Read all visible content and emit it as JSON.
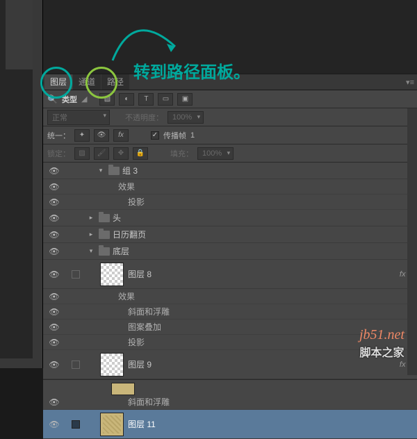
{
  "annotation": {
    "text": "转到路径面板。"
  },
  "tabs": {
    "layers": "图层",
    "channels": "通道",
    "paths": "路径"
  },
  "filter": {
    "label": "类型"
  },
  "blend": {
    "mode": "正常",
    "opacity_label": "不透明度：",
    "opacity_value": "100%"
  },
  "unify": {
    "label": "统一：",
    "propagate_label": "传播帧",
    "propagate_value": "1"
  },
  "lock": {
    "label": "锁定：",
    "fill_label": "填充：",
    "fill_value": "100%"
  },
  "layers_tree": {
    "group3": "组 3",
    "fx": "效果",
    "drop_shadow": "投影",
    "head": "头",
    "calendar": "日历翻页",
    "base": "底层",
    "layer8": "图层 8",
    "bevel": "斜面和浮雕",
    "pattern": "图案叠加",
    "layer9": "图层 9",
    "layer11": "图层 11",
    "fx_badge": "fx"
  },
  "watermark": {
    "url": "jb51.net",
    "name": "脚本之家"
  }
}
